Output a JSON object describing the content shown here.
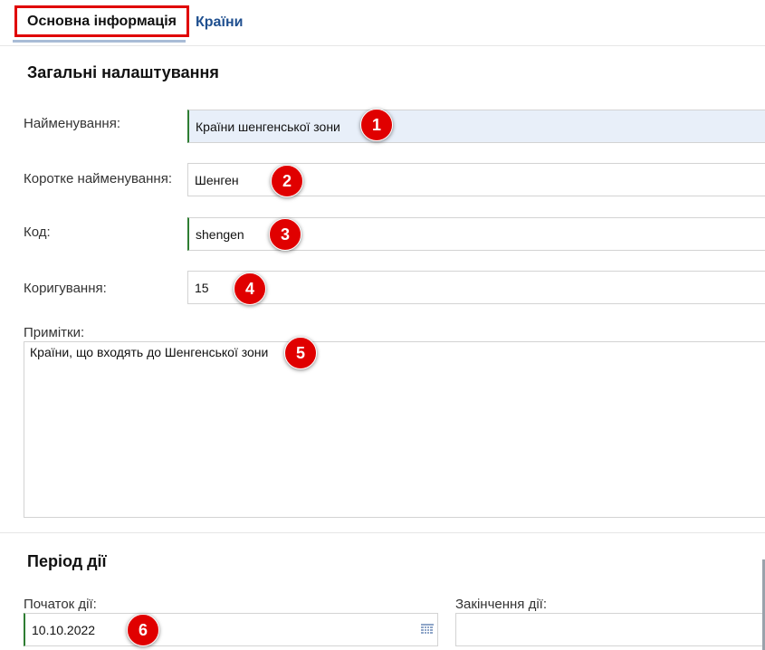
{
  "tabs": [
    {
      "label": "Основна інформація"
    },
    {
      "label": "Країни"
    }
  ],
  "general": {
    "title": "Загальні налаштування",
    "name": {
      "label": "Найменування:",
      "value": "Країни шенгенської зони",
      "badge": "1"
    },
    "short_name": {
      "label": "Коротке найменування:",
      "value": "Шенген",
      "badge": "2"
    },
    "code": {
      "label": "Код:",
      "value": "shengen",
      "badge": "3"
    },
    "correction": {
      "label": "Коригування:",
      "value": "15",
      "badge": "4"
    },
    "notes": {
      "label": "Примітки:",
      "value": "Країни, що входять до Шенгенської зони",
      "badge": "5"
    }
  },
  "period": {
    "title": "Період дії",
    "start": {
      "label": "Початок дії:",
      "value": "10.10.2022",
      "badge": "6"
    },
    "end": {
      "label": "Закінчення дії:",
      "value": ""
    }
  },
  "colors": {
    "badge": "#e00000",
    "tab_link": "#1f4f8f",
    "required_marker": "#2e7d32"
  },
  "icons": {
    "date_picker": "calendar-icon"
  }
}
